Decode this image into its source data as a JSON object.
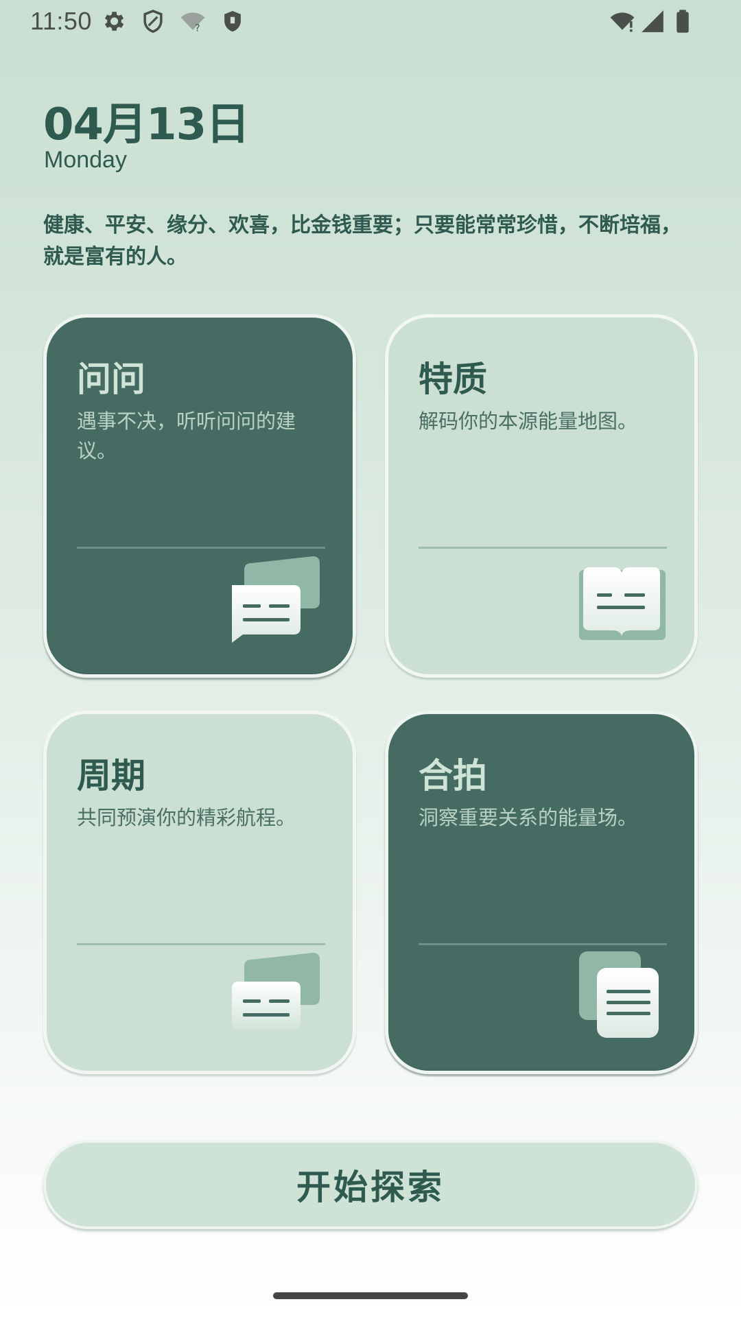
{
  "status_bar": {
    "time": "11:50",
    "left_icons": [
      "gear-icon",
      "shield-icon",
      "wifi-question-icon",
      "shield-filled-icon"
    ],
    "right_icons": [
      "wifi-icon",
      "signal-icon",
      "battery-icon"
    ]
  },
  "header": {
    "date": "04月13日",
    "weekday": "Monday",
    "quote": "健康、平安、缘分、欢喜，比金钱重要；只要能常常珍惜，不断培福，就是富有的人。"
  },
  "cards": [
    {
      "title": "问问",
      "desc": "遇事不决，听听问问的建议。",
      "style": "dark",
      "icon": "chat-bubbles-icon"
    },
    {
      "title": "特质",
      "desc": "解码你的本源能量地图。",
      "style": "light",
      "icon": "open-book-icon"
    },
    {
      "title": "周期",
      "desc": "共同预演你的精彩航程。",
      "style": "light",
      "icon": "chat-bubbles-icon"
    },
    {
      "title": "合拍",
      "desc": "洞察重要关系的能量场。",
      "style": "dark",
      "icon": "stacked-cards-icon"
    }
  ],
  "explore_button": {
    "label": "开始探索"
  },
  "colors": {
    "dark_card": "#456b62",
    "light_card": "#cbdfd2",
    "text_primary": "#2f5a4f"
  }
}
